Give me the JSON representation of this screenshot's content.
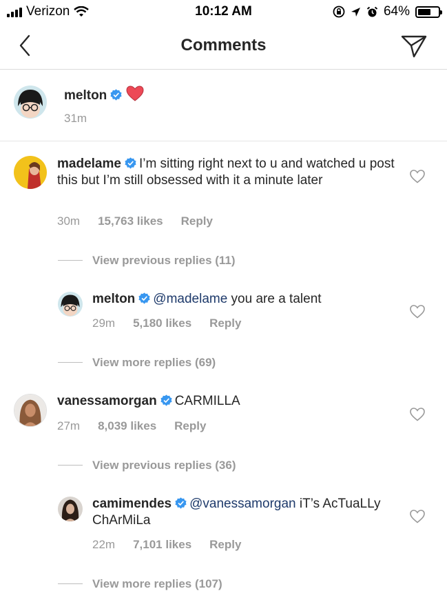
{
  "status": {
    "carrier": "Verizon",
    "time": "10:12 AM",
    "battery": "64%",
    "battery_level": 0.64
  },
  "header": {
    "title": "Comments"
  },
  "caption": {
    "username": "melton",
    "time": "31m"
  },
  "comments": [
    {
      "username": "madelame",
      "text": "I’m sitting right next to u and watched u post this but I’m still obsessed with it a minute later",
      "time": "30m",
      "likes": "15,763 likes",
      "reply": "Reply"
    },
    {
      "username": "melton",
      "mention": "@madelame",
      "text": " you are a talent",
      "time": "29m",
      "likes": "5,180 likes",
      "reply": "Reply"
    },
    {
      "username": "vanessamorgan",
      "text": "CARMILLA",
      "time": "27m",
      "likes": "8,039 likes",
      "reply": "Reply"
    },
    {
      "username": "camimendes",
      "mention": "@vanessamorgan",
      "text": " iT’s AcTuaLLy ChArMiLa",
      "time": "22m",
      "likes": "7,101 likes",
      "reply": "Reply"
    }
  ],
  "threads": [
    {
      "previous": "View previous replies (11)",
      "more": "View more replies (69)"
    },
    {
      "previous": "View previous replies (36)",
      "more": "View more replies (107)"
    }
  ],
  "colors": {
    "verified": "#3897f0",
    "heart_red": "#ed4956",
    "mention": "#1e3a6b",
    "secondary": "#999999"
  }
}
